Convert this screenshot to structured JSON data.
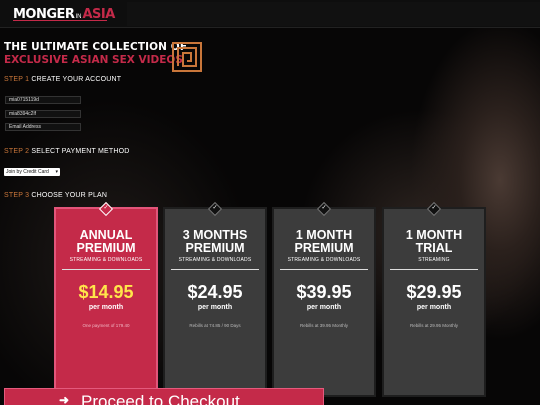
{
  "header": {
    "logo_main": "MONGER",
    "logo_in": "IN",
    "logo_accent": "ASIA"
  },
  "headline": {
    "line1": "THE ULTIMATE COLLECTION OF",
    "line2": "EXCLUSIVE ASIAN SEX VIDEOS"
  },
  "steps": {
    "step1_num": "STEP 1",
    "step1_text": "CREATE YOUR ACCOUNT",
    "step2_num": "STEP 2",
    "step2_text": "SELECT PAYMENT METHOD",
    "step3_num": "STEP 3",
    "step3_text": "CHOOSE YOUR PLAN"
  },
  "account": {
    "username": "mia0715119d",
    "password": "mia8394c2lf",
    "email_placeholder": "Email Address"
  },
  "payment": {
    "selected": "Join by Credit Card"
  },
  "plans": [
    {
      "name1": "ANNUAL",
      "name2": "PREMIUM",
      "sub": "STREAMING & DOWNLOADS",
      "price": "$14.95",
      "per": "per month",
      "note": "One payment of 179.40",
      "selected": true
    },
    {
      "name1": "3 MONTHS",
      "name2": "PREMIUM",
      "sub": "STREAMING & DOWNLOADS",
      "price": "$24.95",
      "per": "per month",
      "note": "Rebills at 74.85 / 90 Days",
      "selected": false
    },
    {
      "name1": "1 MONTH",
      "name2": "PREMIUM",
      "sub": "STREAMING & DOWNLOADS",
      "price": "$39.95",
      "per": "per month",
      "note": "Rebills at 39.95 Monthly",
      "selected": false
    },
    {
      "name1": "1 MONTH",
      "name2": "TRIAL",
      "sub": "STREAMING",
      "price": "$29.95",
      "per": "per month",
      "note": "Rebills at 29.95 Monthly",
      "selected": false
    }
  ],
  "checkout": {
    "label": "Proceed to Checkout",
    "icon": "arrow-right-icon"
  },
  "colors": {
    "accent": "#c42a49",
    "step_number": "#c9763a",
    "price_highlight": "#ffe64a"
  }
}
